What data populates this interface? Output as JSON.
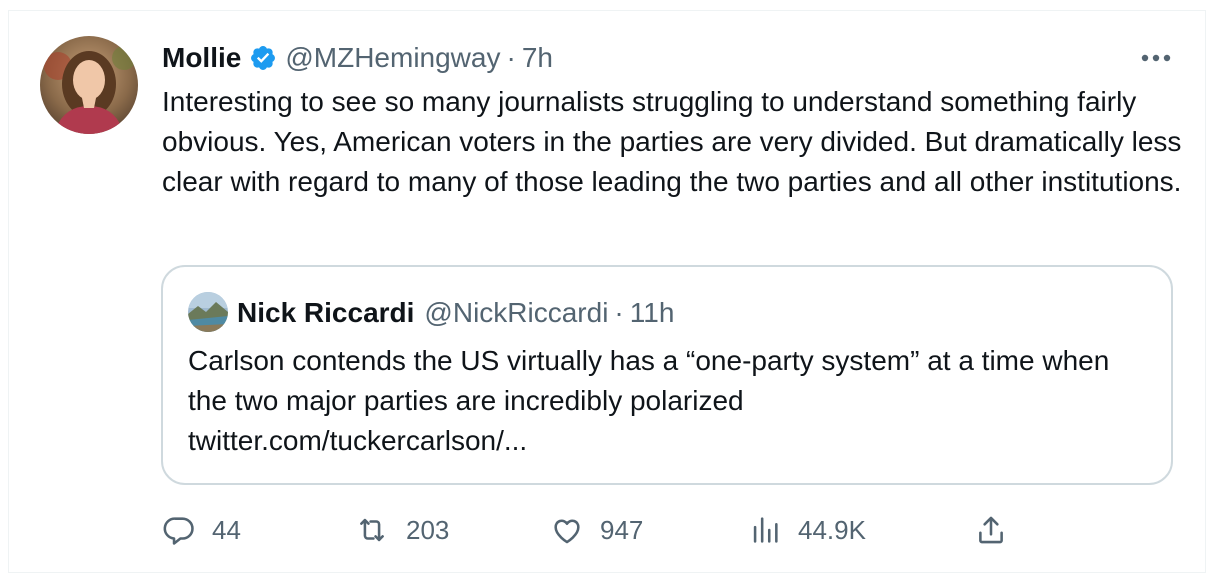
{
  "tweet": {
    "display_name": "Mollie",
    "handle": "@MZHemingway",
    "separator": "·",
    "time": "7h",
    "text": "Interesting to see so many journalists struggling to understand something fairly obvious. Yes, American voters in the parties are very divided. But dramatically less clear with regard to many of those leading the two parties and all other institutions.",
    "verified_icon": "verified-badge-icon",
    "more_icon": "more-options-icon"
  },
  "quote": {
    "display_name": "Nick Riccardi",
    "handle": "@NickRiccardi",
    "separator": "·",
    "time": "11h",
    "text": "Carlson contends the US virtually has a “one-party system” at a time when the two major parties are incredibly polarized",
    "link": "twitter.com/tuckercarlson/..."
  },
  "actions": {
    "replies": "44",
    "retweets": "203",
    "likes": "947",
    "views": "44.9K"
  },
  "colors": {
    "text_primary": "#0f1419",
    "text_secondary": "#536471",
    "verified_blue": "#1d9bf0",
    "border": "#cfd9de"
  }
}
